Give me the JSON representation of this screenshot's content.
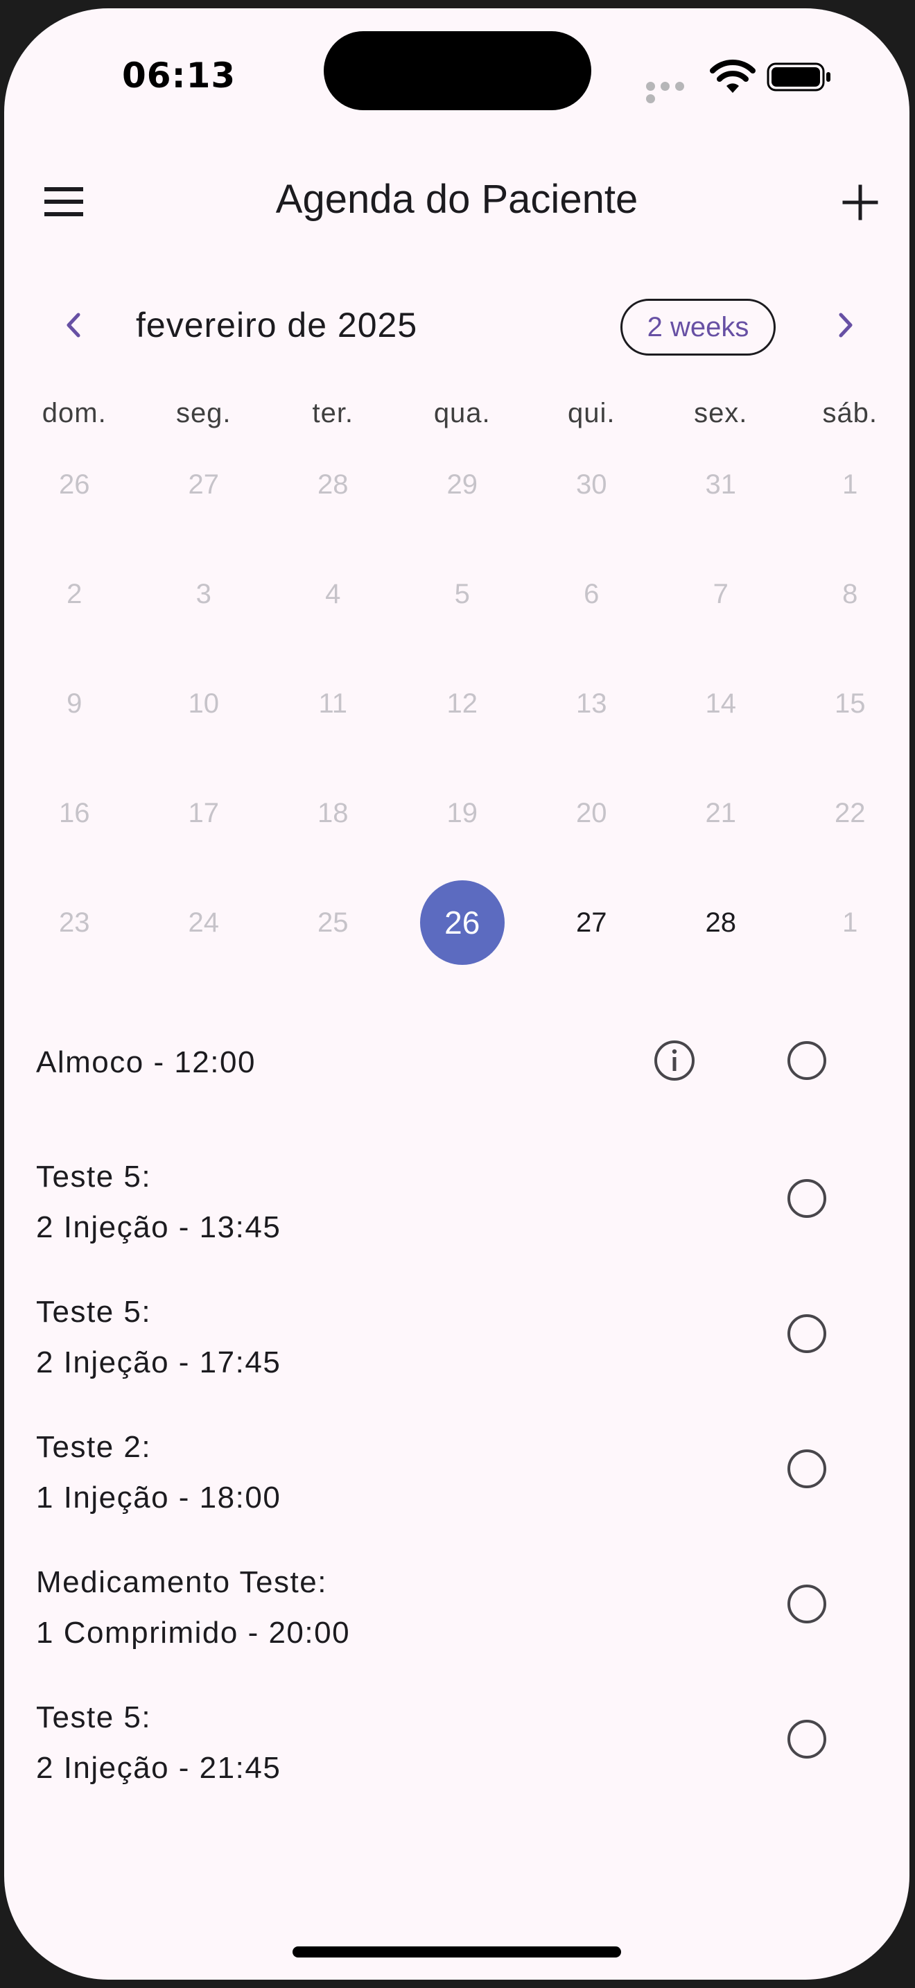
{
  "status_bar": {
    "time": "06:13"
  },
  "app_bar": {
    "title": "Agenda do Paciente"
  },
  "calendar": {
    "month_label": "fevereiro de 2025",
    "format_button": "2 weeks",
    "weekdays": [
      "dom.",
      "seg.",
      "ter.",
      "qua.",
      "qui.",
      "sex.",
      "sáb."
    ],
    "weeks": [
      [
        "26",
        "27",
        "28",
        "29",
        "30",
        "31",
        "1"
      ],
      [
        "2",
        "3",
        "4",
        "5",
        "6",
        "7",
        "8"
      ],
      [
        "9",
        "10",
        "11",
        "12",
        "13",
        "14",
        "15"
      ],
      [
        "16",
        "17",
        "18",
        "19",
        "20",
        "21",
        "22"
      ],
      [
        "23",
        "24",
        "25",
        "26",
        "27",
        "28",
        "1"
      ]
    ],
    "selected_day": "26"
  },
  "events": [
    {
      "line1": "Almoco - 12:00",
      "line2": "",
      "has_info": true
    },
    {
      "line1": "Teste 5:",
      "line2": "2 Injeção - 13:45",
      "has_info": false
    },
    {
      "line1": "Teste 5:",
      "line2": "2 Injeção - 17:45",
      "has_info": false
    },
    {
      "line1": "Teste 2:",
      "line2": "1 Injeção - 18:00",
      "has_info": false
    },
    {
      "line1": "Medicamento Teste:",
      "line2": "1 Comprimido - 20:00",
      "has_info": false
    },
    {
      "line1": "Teste 5:",
      "line2": "2 Injeção - 21:45",
      "has_info": false
    }
  ],
  "colors": {
    "selected_day": "#5c6bc0",
    "accent": "#6750a4",
    "background": "#fef7fb"
  }
}
